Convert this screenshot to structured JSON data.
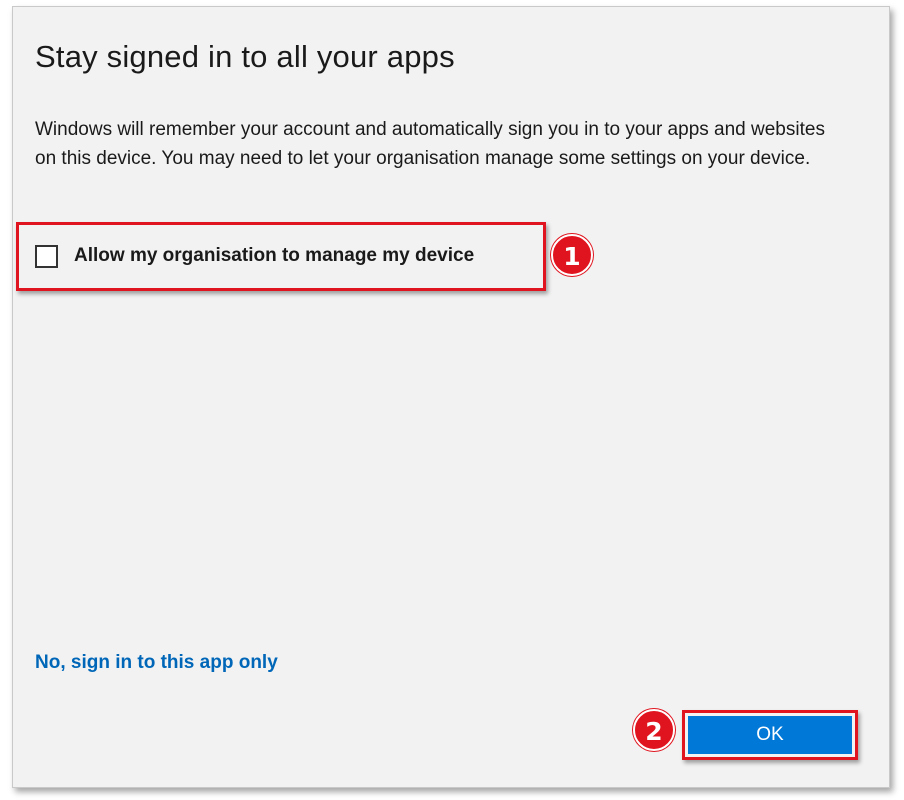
{
  "dialog": {
    "title": "Stay signed in to all your apps",
    "description": "Windows will remember your account and automatically sign you in to your apps and websites on this device. You may need to let your organisation manage some settings on your device."
  },
  "checkbox": {
    "label": "Allow my organisation to manage my device",
    "checked": false
  },
  "link": {
    "label": "No, sign in to this app only"
  },
  "buttons": {
    "ok_label": "OK"
  },
  "annotations": {
    "step1": "1",
    "step2": "2"
  },
  "colors": {
    "accent": "#0078d7",
    "link": "#0067b8",
    "highlight": "#e0141e",
    "dialog_bg": "#f2f2f2"
  }
}
